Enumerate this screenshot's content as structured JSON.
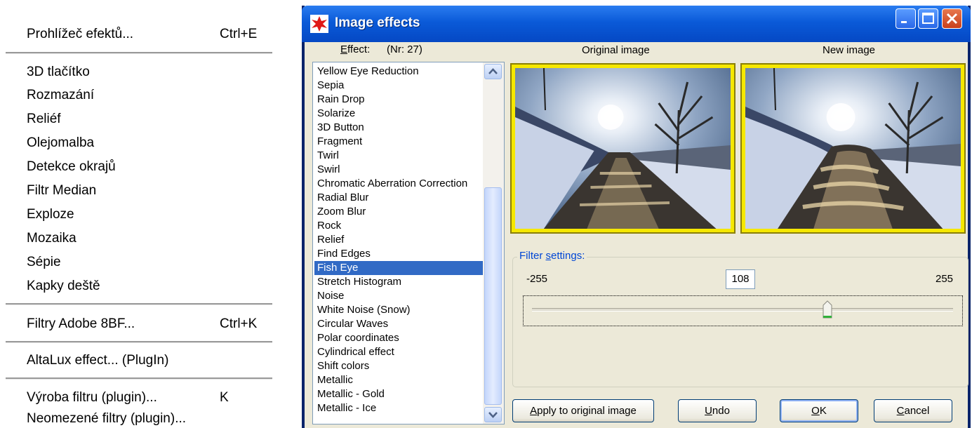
{
  "menu": {
    "items": [
      {
        "label": "Prohlížeč efektů...",
        "shortcut": "Ctrl+E"
      },
      {
        "label": "3D tlačítko"
      },
      {
        "label": "Rozmazání"
      },
      {
        "label": "Reliéf"
      },
      {
        "label": "Olejomalba"
      },
      {
        "label": "Detekce okrajů"
      },
      {
        "label": "Filtr Median"
      },
      {
        "label": "Exploze"
      },
      {
        "label": "Mozaika"
      },
      {
        "label": "Sépie"
      },
      {
        "label": "Kapky deště"
      },
      {
        "label": "Filtry Adobe 8BF...",
        "shortcut": "Ctrl+K"
      },
      {
        "label": "AltaLux effect... (PlugIn)"
      },
      {
        "label": "Výroba filtru (plugin)...",
        "shortcut": "K"
      },
      {
        "label": "Neomezené filtry (plugin)..."
      }
    ]
  },
  "dialog": {
    "title": "Image effects",
    "effect_label": "Effect:",
    "effect_number": "(Nr: 27)",
    "original_label": "Original image",
    "new_label": "New image",
    "effects": [
      "Yellow Eye Reduction",
      "Sepia",
      "Rain Drop",
      "Solarize",
      "3D Button",
      "Fragment",
      "Twirl",
      "Swirl",
      "Chromatic Aberration Correction",
      "Radial Blur",
      "Zoom Blur",
      "Rock",
      "Relief",
      "Find Edges",
      "Fish Eye",
      "Stretch Histogram",
      "Noise",
      "White Noise (Snow)",
      "Circular Waves",
      "Polar coordinates",
      "Cylindrical effect",
      "Shift colors",
      "Metallic",
      "Metallic - Gold",
      "Metallic - Ice"
    ],
    "selected_effect": "Fish Eye",
    "filter_settings_label": "Filter settings:",
    "slider_min": "-255",
    "slider_max": "255",
    "slider_value": "108",
    "buttons": {
      "apply": "Apply to original image",
      "undo": "Undo",
      "ok": "OK",
      "cancel": "Cancel"
    }
  },
  "colors": {
    "titlebar": "#0a5ad8",
    "selection": "#316ac5",
    "image_frame": "#f6e800",
    "group_title": "#0046d5"
  }
}
